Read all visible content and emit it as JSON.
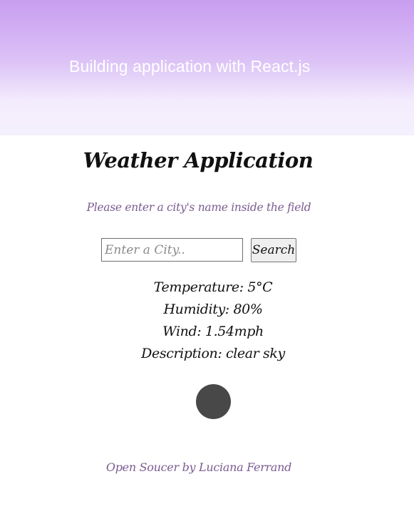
{
  "header": {
    "title": "Building application with React.js"
  },
  "app": {
    "title": "Weather Application",
    "subtitle": "Please enter a city's name inside the field"
  },
  "search": {
    "placeholder": "Enter a City..",
    "value": "",
    "button_label": "Search"
  },
  "weather": {
    "temperature": "Temperature: 5°C",
    "humidity": "Humidity: 80%",
    "wind": "Wind: 1.54mph",
    "description": "Description: clear sky",
    "icon": "weather-icon-placeholder",
    "icon_color": "#484848"
  },
  "footer": {
    "text": "Open Soucer by Luciana Ferrand"
  },
  "colors": {
    "hero_gradient_top": "#c89df0",
    "hero_gradient_bottom": "#f5f0fd",
    "accent_text": "#7b5c92"
  }
}
